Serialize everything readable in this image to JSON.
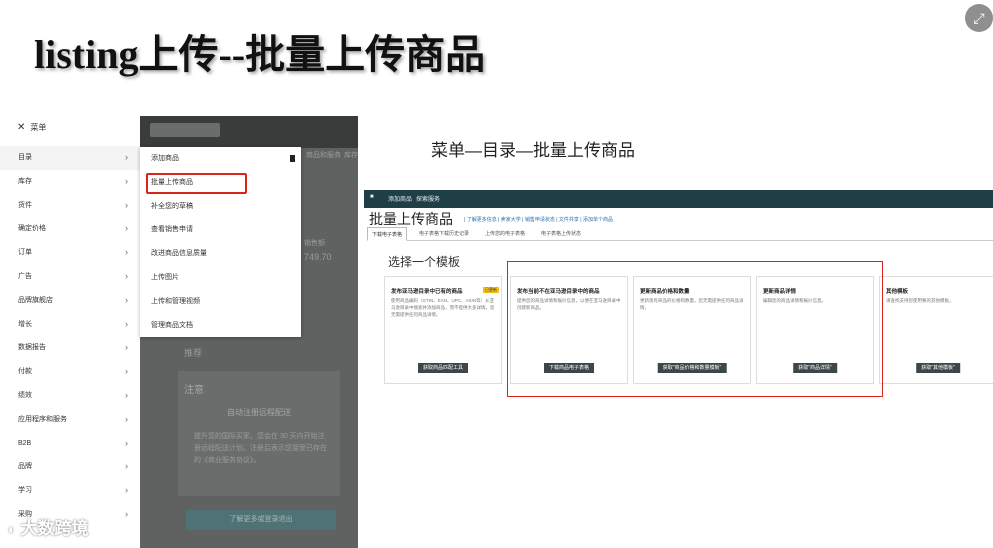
{
  "slide": {
    "title": "listing上传--批量上传商品",
    "caption": "菜单—目录—批量上传商品",
    "expand_icon": "⤢"
  },
  "left_menu": {
    "header": "菜单",
    "items": [
      {
        "label": "目录"
      },
      {
        "label": "库存"
      },
      {
        "label": "货件"
      },
      {
        "label": "确定价格"
      },
      {
        "label": "订单"
      },
      {
        "label": "广告"
      },
      {
        "label": "品牌旗舰店"
      },
      {
        "label": "增长"
      },
      {
        "label": "数据报告"
      },
      {
        "label": "付款"
      },
      {
        "label": "绩效"
      },
      {
        "label": "应用程序和服务"
      },
      {
        "label": "B2B"
      },
      {
        "label": "品牌"
      },
      {
        "label": "学习"
      },
      {
        "label": "采购"
      }
    ]
  },
  "dropdown": {
    "items": [
      {
        "label": "添加商品"
      },
      {
        "label": "批量上传商品"
      },
      {
        "label": "补全您的草稿"
      },
      {
        "label": "查看销售申请"
      },
      {
        "label": "改进商品信息质量"
      },
      {
        "label": "上传图片"
      },
      {
        "label": "上传和管理视频"
      },
      {
        "label": "管理商品文档"
      }
    ]
  },
  "dark_page": {
    "nav_fragments": [
      "商品和服务",
      "库存"
    ],
    "sales_label": "销售额",
    "sales_value": "749.70",
    "section_label": "推荐",
    "notice_title": "注意",
    "notice_heading": "自动注册远程配送",
    "notice_body": "提升您的国际买家。您会在 30 天内开始注册远程配送计划。注册后表示您接受已存在的《商业服务协议》。",
    "button_label": "了解更多或登录退出"
  },
  "right_page": {
    "topbar": [
      "添加商品",
      "探索服务"
    ],
    "title": "批量上传商品",
    "links": "| 了解更多信息 | 卖家大学 | 销售申请状态 | 文件共享 | 添加单个商品",
    "tabs": [
      "下载电子表格",
      "电子表格下载历史记录",
      "上传您的电子表格",
      "电子表格上传状态"
    ],
    "section_title": "选择一个模板",
    "cards": [
      {
        "title": "发布亚马逊目录中已有的商品",
        "badge": "已更新",
        "desc": "使用商品编码（GTIN、EAN、UPC、ASIN等）从亚马逊目录中搜索并添加商品，而不提供大多详情。您无需提供任何商品详情。",
        "button": "获取商品匹配工具"
      },
      {
        "title": "发布当前不在亚马逊目录中的商品",
        "badge": "",
        "desc": "提供您的商品详情和报价信息，以便在亚马逊目录中创建新商品。",
        "button": "下载商品电子表格"
      },
      {
        "title": "更新商品价格和数量",
        "badge": "",
        "desc": "更新现有商品的价格和数量。您无需提供任何商品详情。",
        "button": "获取\"商品价格和数量模板\""
      },
      {
        "title": "更新商品详情",
        "badge": "",
        "desc": "编辑您的商品详情和报价信息。",
        "button": "获取\"商品详情\""
      },
      {
        "title": "其他模板",
        "badge": "",
        "desc": "请查找支持您使用要的其他模板。",
        "button": "获取\"其他模板\""
      }
    ]
  },
  "watermark": {
    "text": "大数跨境"
  }
}
